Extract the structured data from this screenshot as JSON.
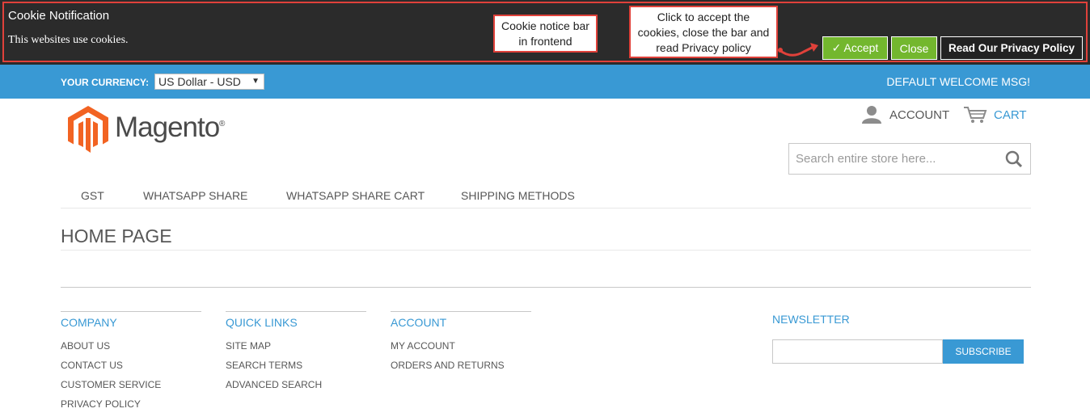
{
  "cookie_bar": {
    "title": "Cookie Notification",
    "message": "This websites use cookies.",
    "accept_label": "✓ Accept",
    "close_label": "Close",
    "policy_label": "Read Our Privacy Policy",
    "accent": "#73b72e",
    "annotation_color": "#e0413a"
  },
  "callouts": {
    "notice_line1": "Cookie notice bar",
    "notice_line2": "in frontend",
    "accept_line1": "Click to accept the",
    "accept_line2": "cookies, close the bar and",
    "accept_line3": "read Privacy policy"
  },
  "topbar": {
    "currency_label": "YOUR CURRENCY:",
    "currency_value": "US Dollar - USD",
    "caret": "▼",
    "welcome": "DEFAULT WELCOME MSG!",
    "color": "#3999d4"
  },
  "header": {
    "logo_text": "Magento",
    "logo_reg": "®",
    "account_label": "ACCOUNT",
    "cart_label": "CART",
    "search_placeholder": "Search entire store here..."
  },
  "nav": {
    "items": [
      "GST",
      "WHATSAPP SHARE",
      "WHATSAPP SHARE CART",
      "SHIPPING METHODS"
    ]
  },
  "main": {
    "page_title": "HOME PAGE"
  },
  "footer": {
    "columns": [
      {
        "title": "COMPANY",
        "links": [
          "ABOUT US",
          "CONTACT US",
          "CUSTOMER SERVICE",
          "PRIVACY POLICY"
        ]
      },
      {
        "title": "QUICK LINKS",
        "links": [
          "SITE MAP",
          "SEARCH TERMS",
          "ADVANCED SEARCH"
        ]
      },
      {
        "title": "ACCOUNT",
        "links": [
          "MY ACCOUNT",
          "ORDERS AND RETURNS"
        ]
      }
    ],
    "newsletter_title": "NEWSLETTER",
    "subscribe_label": "SUBSCRIBE"
  }
}
